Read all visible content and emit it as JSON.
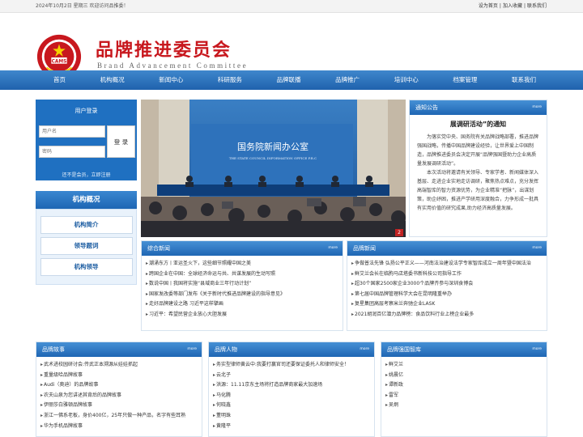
{
  "topbar": {
    "date_welcome": "2024年10月2日 星期三 欢迎访问品推委！",
    "links": [
      "设为首页",
      "|",
      "加入收藏",
      "|",
      "联系我们"
    ]
  },
  "header": {
    "title_cn": "品牌推进委员会",
    "title_en": "Brand Advancement Committee",
    "logo_text": "CAMS"
  },
  "nav": [
    "首页",
    "机构概况",
    "新闻中心",
    "科研服务",
    "品牌联播",
    "品牌推广",
    "培训中心",
    "档案管理",
    "联系我们"
  ],
  "login": {
    "title": "用户登录",
    "username_placeholder": "用户名",
    "password_placeholder": "密码",
    "button": "登 录",
    "register": "还不是会员，立即注册"
  },
  "org": {
    "title": "机构概况",
    "items": [
      "机构简介",
      "领导题词",
      "机构领导"
    ]
  },
  "banner": {
    "backdrop_cn": "国务院新闻办公室",
    "backdrop_en": "THE STATE COUNCIL INFORMATION OFFICE P.R.C",
    "page_num": "2"
  },
  "notice": {
    "title": "通知公告",
    "more": "more",
    "headline": "展调研活动”的通知",
    "para1": "为落实党中央、国务院有关品牌战略部署，推进品牌强国战略，传播中国品牌建设经验，让世界爱上中国制造，品牌推进委员会决定开展“品牌强国暨助力企业高质量发展调研活动”。",
    "para2": "本次活动将邀请有关领导、专家学者、新闻媒体深入基层、走进企业实地走访调研，聚焦热点难点，充分发挥高端智库的智力资源优势，为企业精准“把脉”，出谋划策，助企纾困，推进产学研用深度融合，力争形成一批具有实用价值的研究成果,助力经济高质量发展。"
  },
  "news_comprehensive": {
    "title": "综合新闻",
    "more": "more",
    "items": [
      "潮涌东方丨亚运圣火下，这些细节照耀中国之美",
      "跨国企业在中国：全球经济命运与共、共谋发展的生动写照",
      "数说中国丨我国将实施“县域商业三年行动计划”",
      "国家发改委等部门发布《关于新时代推进品牌建设的指导意见》",
      "走好品牌建设之路 习近平这样擘画",
      "习近平：希望民营企业放心大胆发展"
    ]
  },
  "news_brand": {
    "title": "品牌新闻",
    "more": "more",
    "items": [
      "争做普法先锋 弘扬公平正义——河南法治建设法学专家智库成立一周年暨中国法治",
      "鲜艾兰会长在临朐马店塔委书新科技公司指导工作",
      "超30个国家2500家企业3000个品牌齐参与深圳食博会",
      "第七届中国品牌管理科学大会在昆明隆重举办",
      "复星集团高层考察米兰奔驰企业LASK",
      "2021胡润百亿潜力品牌榜：食品饮料行业上榜企业最多"
    ]
  },
  "brand_story": {
    "title": "品牌故事",
    "more": "more",
    "items": [
      "武术进校园研讨会:传武正本溯源从娃娃抓起",
      "重量级哈品牌故事",
      "Audi（奥迪）的品牌故事",
      "农夫山泉为您讲述其背后的品牌故事",
      "伊丽莎白雅顿品牌故事",
      "浙江一佛系老板，身价400亿，25年只做一种产品，名字有些耳熟",
      "华为手机品牌故事"
    ]
  },
  "brand_people": {
    "title": "品牌人物",
    "more": "more",
    "items": [
      "务实型律师黄云中:我要打赢官司还要保证委托人和律师安全！",
      "云北子",
      "洪源：11.11京东主场将打造品牌商家最大加速场",
      "马化腾",
      "何晓鑫",
      "董明珠",
      "黄隆平"
    ]
  },
  "brand_think": {
    "title": "品牌强国智库",
    "more": "more",
    "items": [
      "鲜艾兰",
      "姚晨亿",
      "谭新政",
      "雷军",
      "吴炯"
    ]
  },
  "colors": {
    "accent": "#1f66b4",
    "brand_red": "#c8181e"
  }
}
